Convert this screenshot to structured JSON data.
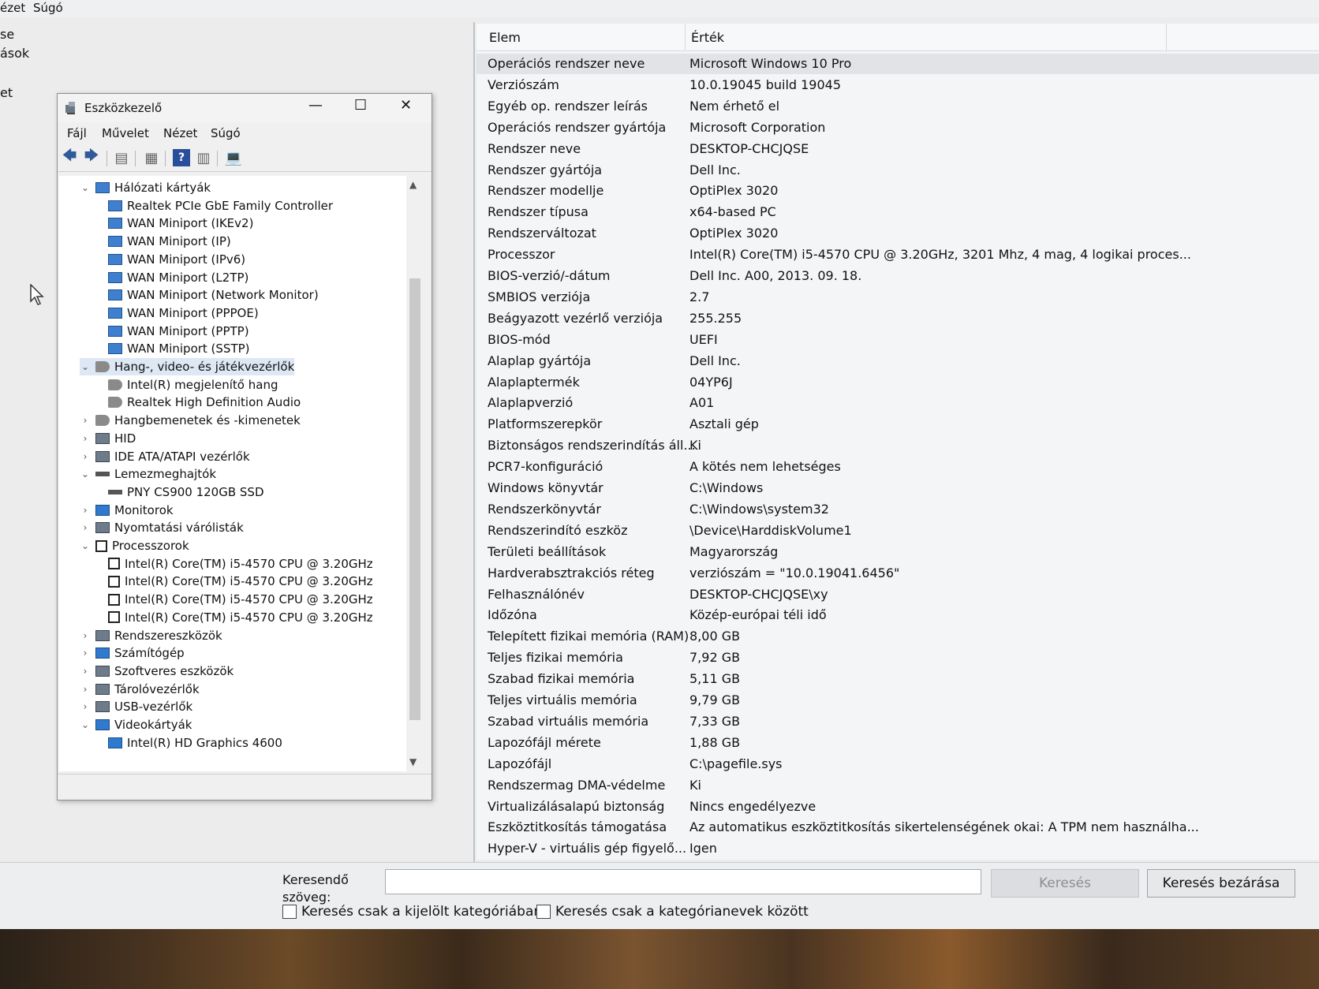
{
  "main_menu": {
    "view": "ézet",
    "help": "Súgó"
  },
  "left_pane": {
    "item_1": "se",
    "item_2": "ások",
    "item_3": "et"
  },
  "columns": {
    "item": "Elem",
    "value": "Érték"
  },
  "rows": [
    {
      "k": "Operációs rendszer neve",
      "v": "Microsoft Windows 10 Pro"
    },
    {
      "k": "Verziószám",
      "v": "10.0.19045 build 19045"
    },
    {
      "k": "Egyéb op. rendszer leírás",
      "v": "Nem érhető el"
    },
    {
      "k": "Operációs rendszer gyártója",
      "v": "Microsoft Corporation"
    },
    {
      "k": "Rendszer neve",
      "v": "DESKTOP-CHCJQSE"
    },
    {
      "k": "Rendszer gyártója",
      "v": "Dell Inc."
    },
    {
      "k": "Rendszer modellje",
      "v": "OptiPlex 3020"
    },
    {
      "k": "Rendszer típusa",
      "v": "x64-based PC"
    },
    {
      "k": "Rendszerváltozat",
      "v": "OptiPlex 3020"
    },
    {
      "k": "Processzor",
      "v": "Intel(R) Core(TM) i5-4570 CPU @ 3.20GHz, 3201 Mhz, 4 mag, 4 logikai proces..."
    },
    {
      "k": "BIOS-verzió/-dátum",
      "v": "Dell Inc. A00, 2013. 09. 18."
    },
    {
      "k": "SMBIOS verziója",
      "v": "2.7"
    },
    {
      "k": "Beágyazott vezérlő verziója",
      "v": "255.255"
    },
    {
      "k": "BIOS-mód",
      "v": "UEFI"
    },
    {
      "k": "Alaplap gyártója",
      "v": "Dell Inc."
    },
    {
      "k": "Alaplaptermék",
      "v": "04YP6J"
    },
    {
      "k": "Alaplapverzió",
      "v": "A01"
    },
    {
      "k": "Platformszerepkör",
      "v": "Asztali gép"
    },
    {
      "k": "Biztonságos rendszerindítás áll...",
      "v": "Ki"
    },
    {
      "k": "PCR7-konfiguráció",
      "v": "A kötés nem lehetséges"
    },
    {
      "k": "Windows könyvtár",
      "v": "C:\\Windows"
    },
    {
      "k": "Rendszerkönyvtár",
      "v": "C:\\Windows\\system32"
    },
    {
      "k": "Rendszerindító eszköz",
      "v": "\\Device\\HarddiskVolume1"
    },
    {
      "k": "Területi beállítások",
      "v": "Magyarország"
    },
    {
      "k": "Hardverabsztrakciós réteg",
      "v": "verziószám = \"10.0.19041.6456\""
    },
    {
      "k": "Felhasználónév",
      "v": "DESKTOP-CHCJQSE\\xy"
    },
    {
      "k": "Időzóna",
      "v": "Közép-európai téli idő"
    },
    {
      "k": "Telepített fizikai memória (RAM)",
      "v": "8,00 GB"
    },
    {
      "k": "Teljes fizikai memória",
      "v": "7,92 GB"
    },
    {
      "k": "Szabad fizikai memória",
      "v": "5,11 GB"
    },
    {
      "k": "Teljes virtuális memória",
      "v": "9,79 GB"
    },
    {
      "k": "Szabad virtuális memória",
      "v": "7,33 GB"
    },
    {
      "k": "Lapozófájl mérete",
      "v": "1,88 GB"
    },
    {
      "k": "Lapozófájl",
      "v": "C:\\pagefile.sys"
    },
    {
      "k": "Rendszermag DMA-védelme",
      "v": "Ki"
    },
    {
      "k": "Virtualizálásalapú biztonság",
      "v": "Nincs engedélyezve"
    },
    {
      "k": "Eszköztitkosítás támogatása",
      "v": "Az automatikus eszköztitkosítás sikertelenségének okai: A TPM nem használha..."
    },
    {
      "k": "Hyper-V - virtuális gép figyelő...",
      "v": "Igen"
    }
  ],
  "search": {
    "label_line1": "Keresendő",
    "label_line2": "szöveg:",
    "input_value": "",
    "search_button": "Keresés",
    "close_button": "Keresés bezárása",
    "checkbox_selected_category": "Keresés csak a kijelölt kategóriában",
    "checkbox_category_names": "Keresés csak a kategórianevek között"
  },
  "device_manager": {
    "title": "Eszközkezelő",
    "menu": {
      "file": "Fájl",
      "action": "Művelet",
      "view": "Nézet",
      "help": "Súgó"
    },
    "tree": [
      {
        "label": "Hálózati kártyák",
        "level": 1,
        "exp": "v",
        "icon": "network-icon"
      },
      {
        "label": "Realtek PCIe GbE Family Controller",
        "level": 2,
        "icon": "network-icon"
      },
      {
        "label": "WAN Miniport (IKEv2)",
        "level": 2,
        "icon": "network-icon"
      },
      {
        "label": "WAN Miniport (IP)",
        "level": 2,
        "icon": "network-icon"
      },
      {
        "label": "WAN Miniport (IPv6)",
        "level": 2,
        "icon": "network-icon"
      },
      {
        "label": "WAN Miniport (L2TP)",
        "level": 2,
        "icon": "network-icon"
      },
      {
        "label": "WAN Miniport (Network Monitor)",
        "level": 2,
        "icon": "network-icon"
      },
      {
        "label": "WAN Miniport (PPPOE)",
        "level": 2,
        "icon": "network-icon"
      },
      {
        "label": "WAN Miniport (PPTP)",
        "level": 2,
        "icon": "network-icon"
      },
      {
        "label": "WAN Miniport (SSTP)",
        "level": 2,
        "icon": "network-icon"
      },
      {
        "label": "Hang-, video- és játékvezérlők",
        "level": 1,
        "exp": "v",
        "icon": "speaker-icon",
        "selected": true
      },
      {
        "label": "Intel(R) megjelenítő hang",
        "level": 2,
        "icon": "speaker-icon"
      },
      {
        "label": "Realtek High Definition Audio",
        "level": 2,
        "icon": "speaker-icon"
      },
      {
        "label": "Hangbemenetek és -kimenetek",
        "level": 1,
        "exp": ">",
        "icon": "speaker-icon"
      },
      {
        "label": "HID",
        "level": 1,
        "exp": ">",
        "icon": "keyboard-icon"
      },
      {
        "label": "IDE ATA/ATAPI vezérlők",
        "level": 1,
        "exp": ">",
        "icon": "controller-icon"
      },
      {
        "label": "Lemezmeghajtók",
        "level": 1,
        "exp": "v",
        "icon": "disk-icon"
      },
      {
        "label": "PNY CS900 120GB SSD",
        "level": 2,
        "icon": "disk-icon"
      },
      {
        "label": "Monitorok",
        "level": 1,
        "exp": ">",
        "icon": "monitor-icon"
      },
      {
        "label": "Nyomtatási várólisták",
        "level": 1,
        "exp": ">",
        "icon": "printer-icon"
      },
      {
        "label": "Processzorok",
        "level": 1,
        "exp": "v",
        "icon": "cpu-icon"
      },
      {
        "label": "Intel(R) Core(TM) i5-4570 CPU @ 3.20GHz",
        "level": 2,
        "icon": "cpu-icon"
      },
      {
        "label": "Intel(R) Core(TM) i5-4570 CPU @ 3.20GHz",
        "level": 2,
        "icon": "cpu-icon"
      },
      {
        "label": "Intel(R) Core(TM) i5-4570 CPU @ 3.20GHz",
        "level": 2,
        "icon": "cpu-icon"
      },
      {
        "label": "Intel(R) Core(TM) i5-4570 CPU @ 3.20GHz",
        "level": 2,
        "icon": "cpu-icon"
      },
      {
        "label": "Rendszereszközök",
        "level": 1,
        "exp": ">",
        "icon": "system-icon"
      },
      {
        "label": "Számítógép",
        "level": 1,
        "exp": ">",
        "icon": "monitor-icon"
      },
      {
        "label": "Szoftveres eszközök",
        "level": 1,
        "exp": ">",
        "icon": "software-icon"
      },
      {
        "label": "Tárolóvezérlők",
        "level": 1,
        "exp": ">",
        "icon": "storage-icon"
      },
      {
        "label": "USB-vezérlők",
        "level": 1,
        "exp": ">",
        "icon": "usb-icon"
      },
      {
        "label": "Videokártyák",
        "level": 1,
        "exp": "v",
        "icon": "monitor-icon"
      },
      {
        "label": "Intel(R) HD Graphics 4600",
        "level": 2,
        "icon": "monitor-icon"
      }
    ]
  }
}
